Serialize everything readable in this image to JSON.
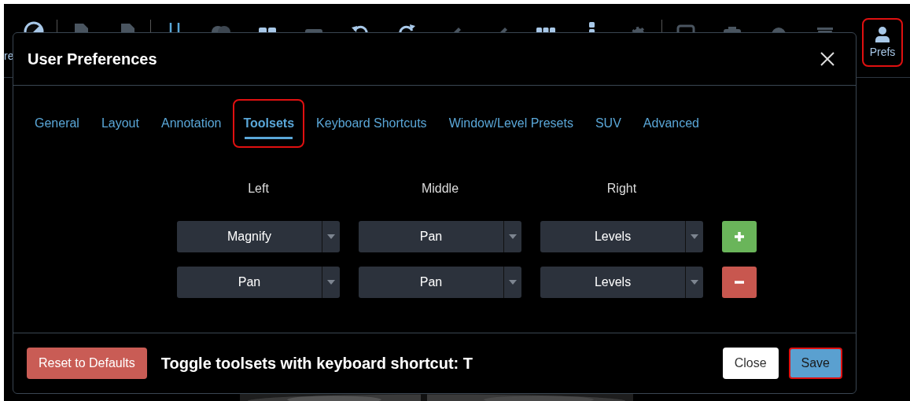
{
  "toolbar": {
    "cut_label": "re",
    "prefs_button": {
      "label": "Prefs",
      "highlighted": true
    }
  },
  "dialog": {
    "title": "User Preferences",
    "tabs": [
      {
        "label": "General",
        "selected": false,
        "highlighted": false
      },
      {
        "label": "Layout",
        "selected": false,
        "highlighted": false
      },
      {
        "label": "Annotation",
        "selected": false,
        "highlighted": false
      },
      {
        "label": "Toolsets",
        "selected": true,
        "highlighted": true
      },
      {
        "label": "Keyboard Shortcuts",
        "selected": false,
        "highlighted": false
      },
      {
        "label": "Window/Level Presets",
        "selected": false,
        "highlighted": false
      },
      {
        "label": "SUV",
        "selected": false,
        "highlighted": false
      },
      {
        "label": "Advanced",
        "selected": false,
        "highlighted": false
      }
    ],
    "columns": [
      "Left",
      "Middle",
      "Right"
    ],
    "toolsets": [
      {
        "values": [
          "Magnify",
          "Pan",
          "Levels"
        ],
        "kind": "add"
      },
      {
        "values": [
          "Pan",
          "Pan",
          "Levels"
        ],
        "kind": "remove"
      }
    ],
    "footer": {
      "reset_button": "Reset to Defaults",
      "hint": "Toggle toolsets with keyboard shortcut: T",
      "close_button": "Close",
      "save_button": {
        "label": "Save",
        "highlighted": true
      }
    }
  }
}
